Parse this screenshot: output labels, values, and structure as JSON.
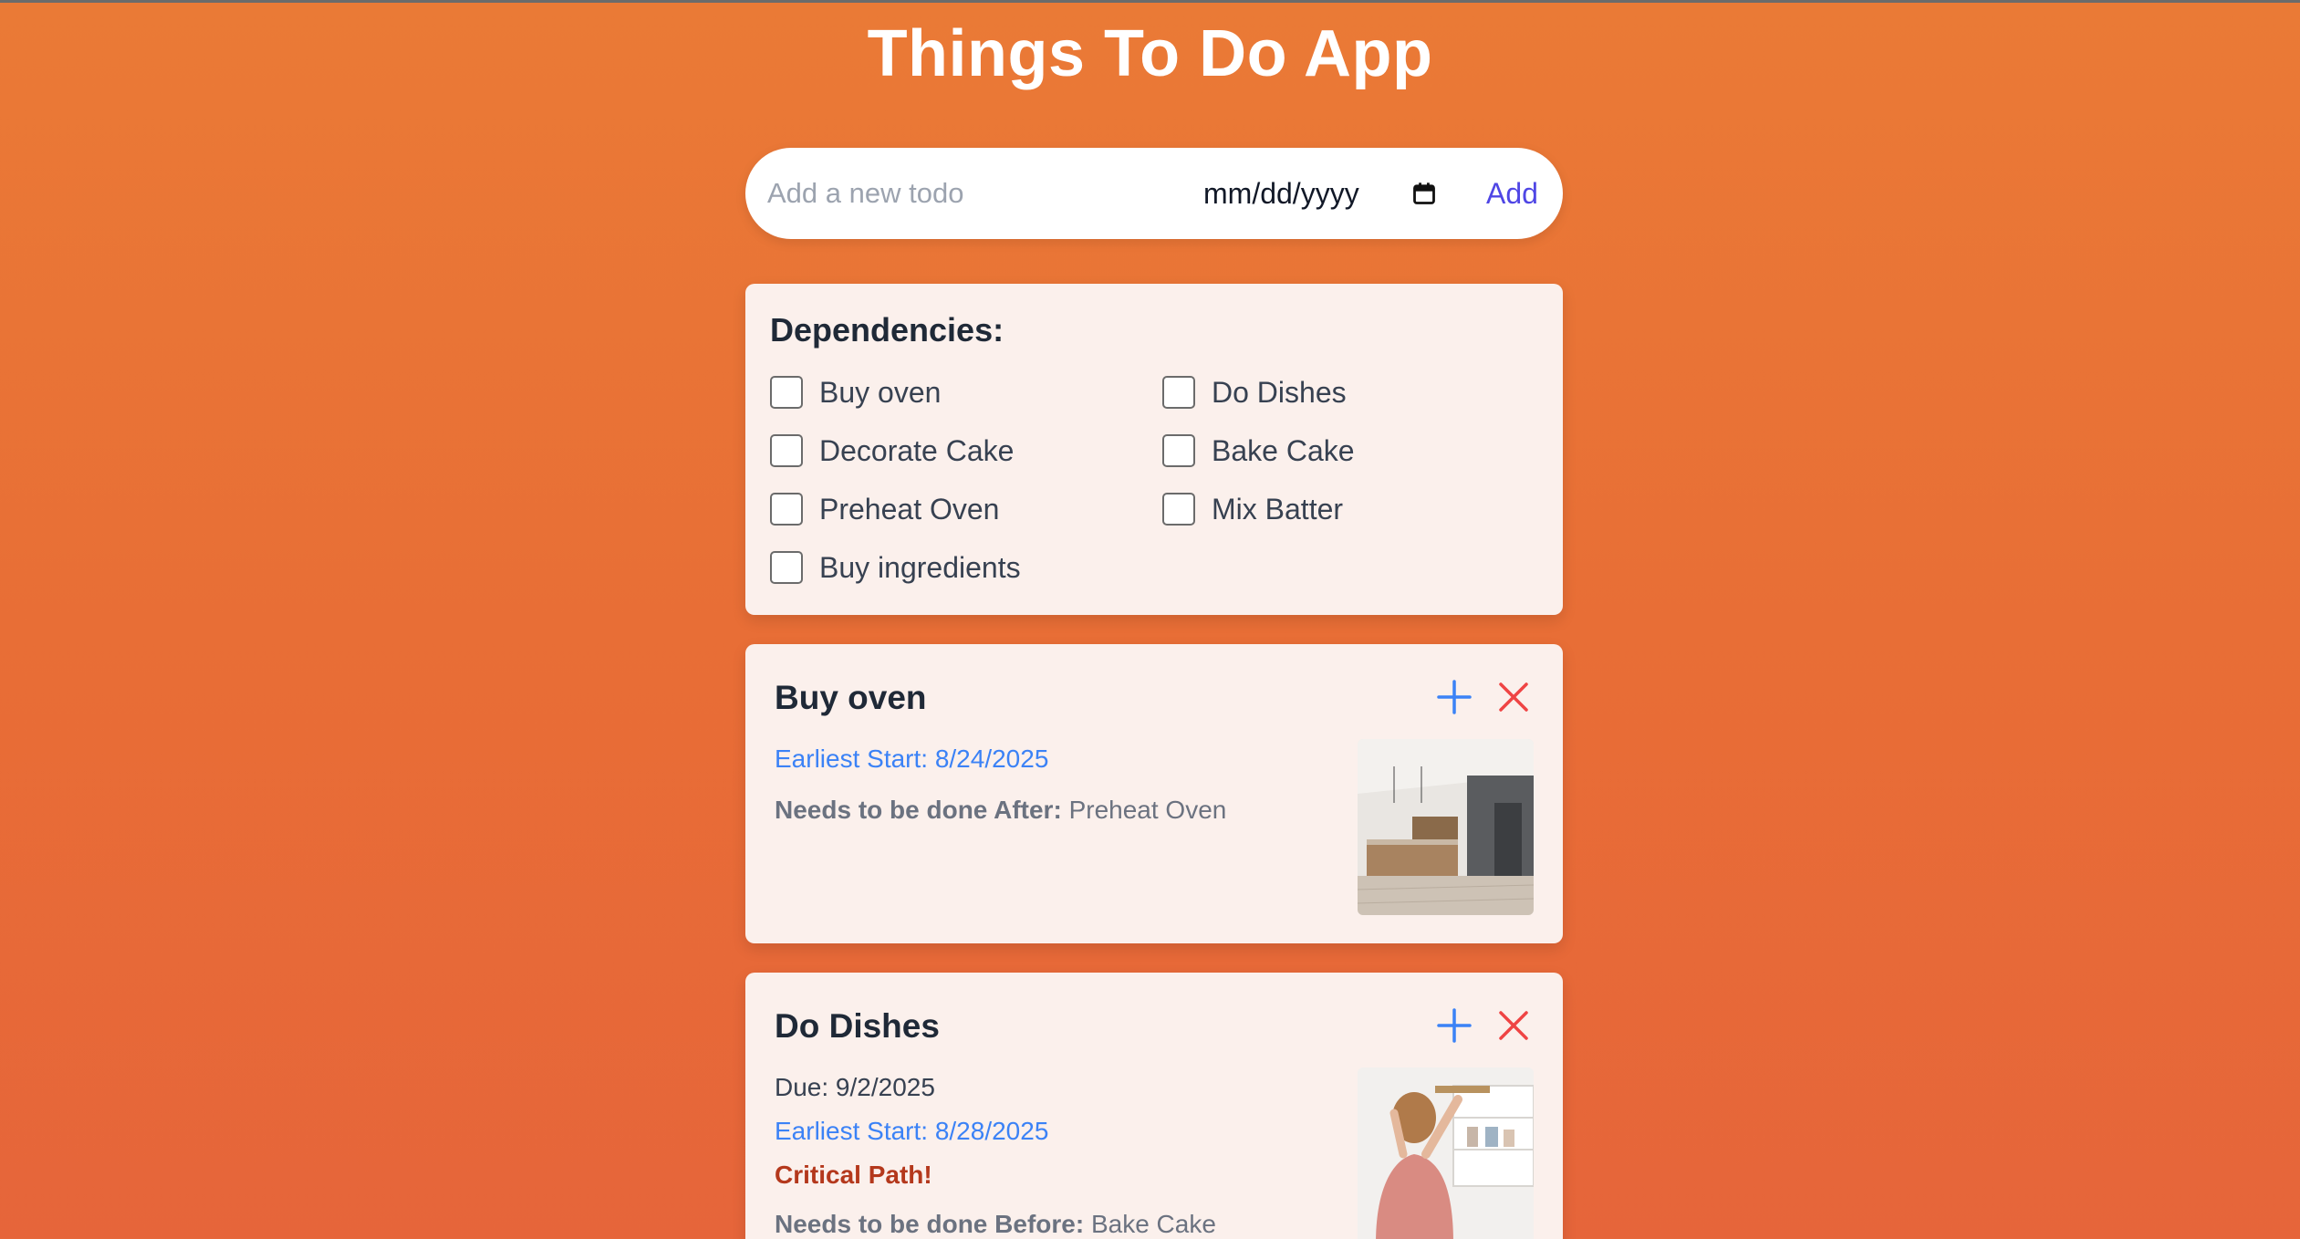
{
  "app": {
    "title": "Things To Do App"
  },
  "add_form": {
    "placeholder": "Add a new todo",
    "date_placeholder": "mm/dd/yyyy",
    "add_label": "Add"
  },
  "dependencies": {
    "title": "Dependencies:",
    "items": [
      {
        "label": "Buy oven",
        "checked": false
      },
      {
        "label": "Do Dishes",
        "checked": false
      },
      {
        "label": "Decorate Cake",
        "checked": false
      },
      {
        "label": "Bake Cake",
        "checked": false
      },
      {
        "label": "Preheat Oven",
        "checked": false
      },
      {
        "label": "Mix Batter",
        "checked": false
      },
      {
        "label": "Buy ingredients",
        "checked": false
      }
    ]
  },
  "todos": [
    {
      "title": "Buy oven",
      "earliest_start": "Earliest Start: 8/24/2025",
      "needs_label": "Needs to be done After:",
      "needs_value": "Preheat Oven",
      "image": "kitchen-photo"
    },
    {
      "title": "Do Dishes",
      "due": "Due: 9/2/2025",
      "earliest_start": "Earliest Start: 8/28/2025",
      "critical": "Critical Path!",
      "needs_label": "Needs to be done Before:",
      "needs_value": "Bake Cake",
      "image": "person-at-cabinet-photo"
    }
  ],
  "colors": {
    "background": "#e96f36",
    "card": "#fbf0ec",
    "accent": "#4f46e5",
    "link_blue": "#3b82f6",
    "delete_red": "#ef4444",
    "critical": "#b4381c"
  },
  "icons": {
    "add_todo": "plus-icon",
    "delete_todo": "close-icon",
    "date_picker": "calendar-icon"
  }
}
